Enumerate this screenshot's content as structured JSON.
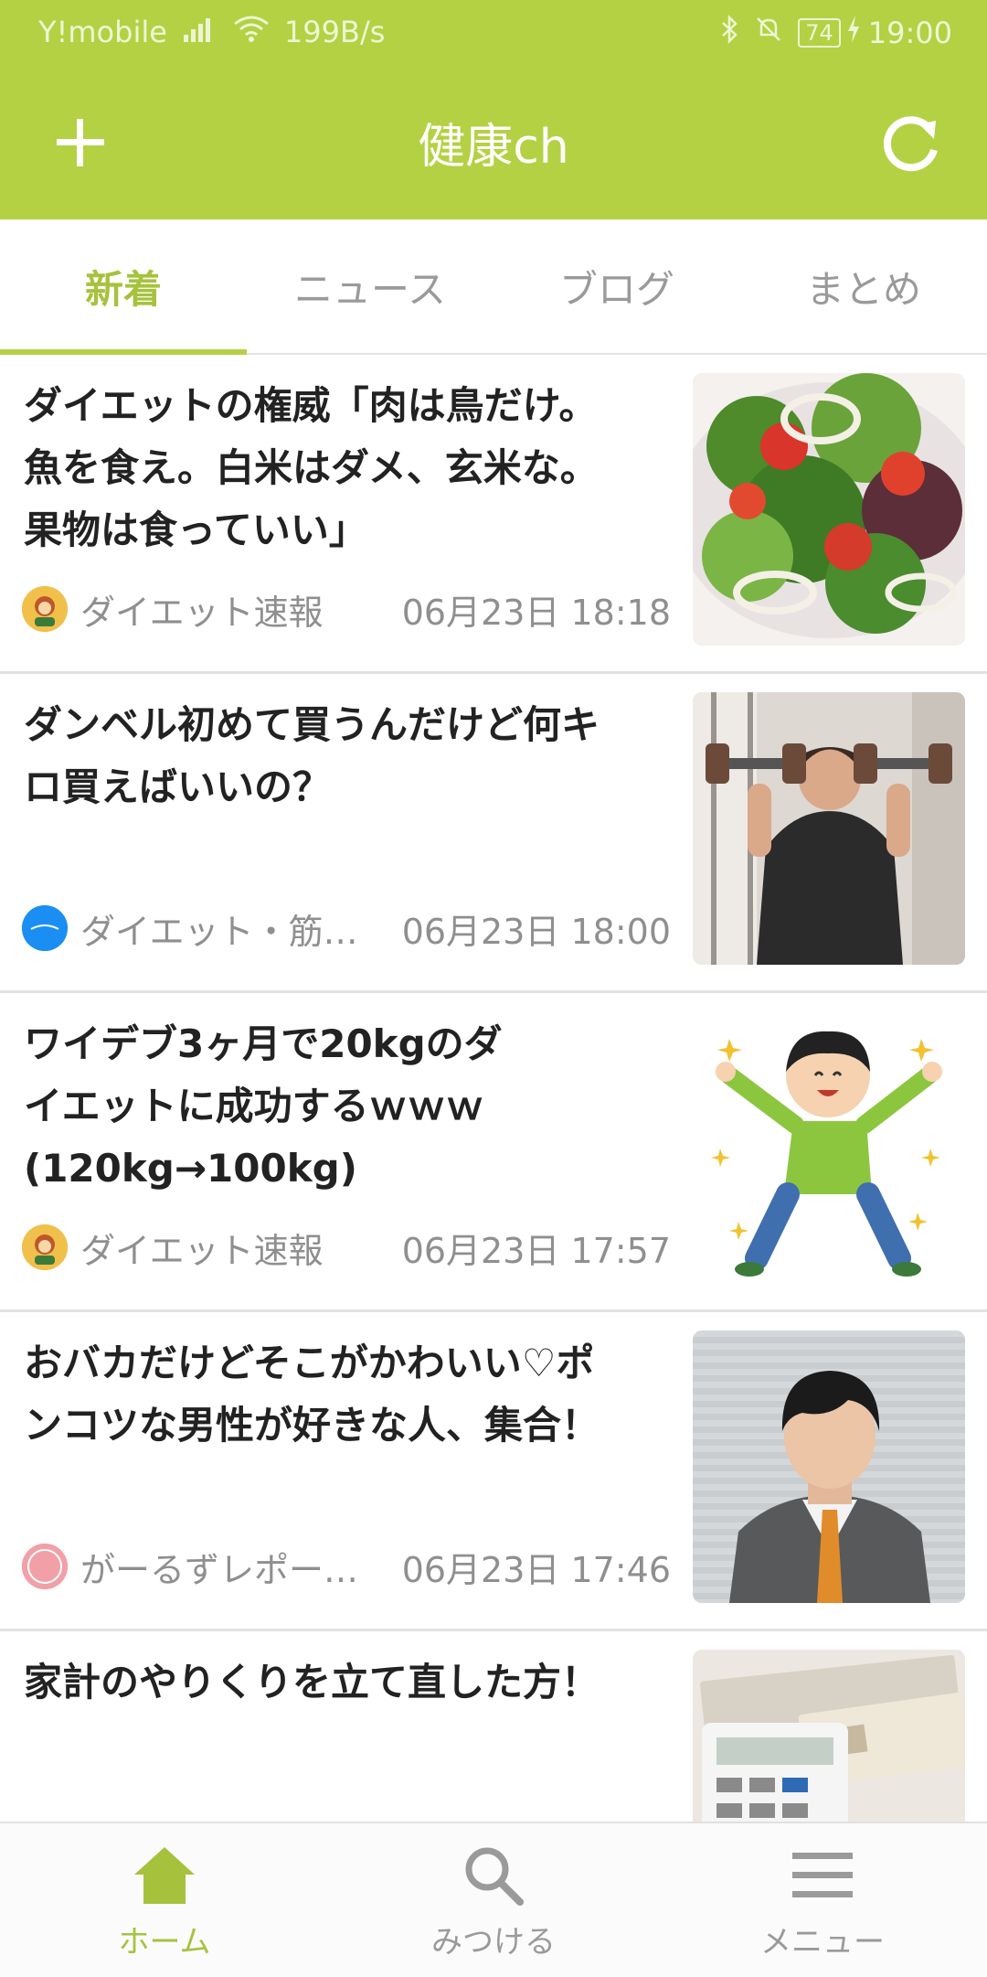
{
  "status_bar": {
    "carrier": "Y!mobile",
    "network_speed": "199B/s",
    "battery": "74",
    "time": "19:00"
  },
  "app_bar": {
    "title": "健康ch",
    "left_icon": "plus-icon",
    "right_icon": "refresh-icon"
  },
  "tabs": [
    {
      "label": "新着",
      "active": true
    },
    {
      "label": "ニュース",
      "active": false
    },
    {
      "label": "ブログ",
      "active": false
    },
    {
      "label": "まとめ",
      "active": false
    }
  ],
  "articles": [
    {
      "title": "ダイエットの権威「肉は鳥だけ。\n魚を食え。白米はダメ、玄米な。\n果物は食っていい」",
      "source": "ダイエット速報",
      "time": "06月23日 18:18",
      "thumbnail": "salad-image"
    },
    {
      "title": "ダンベル初めて買うんだけど何キ\nロ買えばいいの？",
      "source": "ダイエット・筋…",
      "time": "06月23日 18:00",
      "thumbnail": "dumbbell-man-image"
    },
    {
      "title": "ワイデブ3ヶ月で20kgのダ\nイエットに成功するｗｗｗ\n(120kg→100kg)",
      "source": "ダイエット速報",
      "time": "06月23日 17:57",
      "thumbnail": "jumping-man-illustration"
    },
    {
      "title": "おバカだけどそこがかわいい♡ポ\nンコツな男性が好きな人、集合！",
      "source": "がーるずレポー…",
      "time": "06月23日 17:46",
      "thumbnail": "businessman-image"
    },
    {
      "title": "家計のやりくりを立て直した方！",
      "source": "",
      "time": "",
      "thumbnail": "money-calculator-image"
    }
  ],
  "bottom_nav": [
    {
      "label": "ホーム",
      "icon": "home-icon",
      "active": true
    },
    {
      "label": "みつける",
      "icon": "search-icon",
      "active": false
    },
    {
      "label": "メニュー",
      "icon": "menu-icon",
      "active": false
    }
  ],
  "colors": {
    "accent": "#b4d143",
    "active_text": "#a6c23d",
    "inactive_text": "#9a9a9a"
  }
}
